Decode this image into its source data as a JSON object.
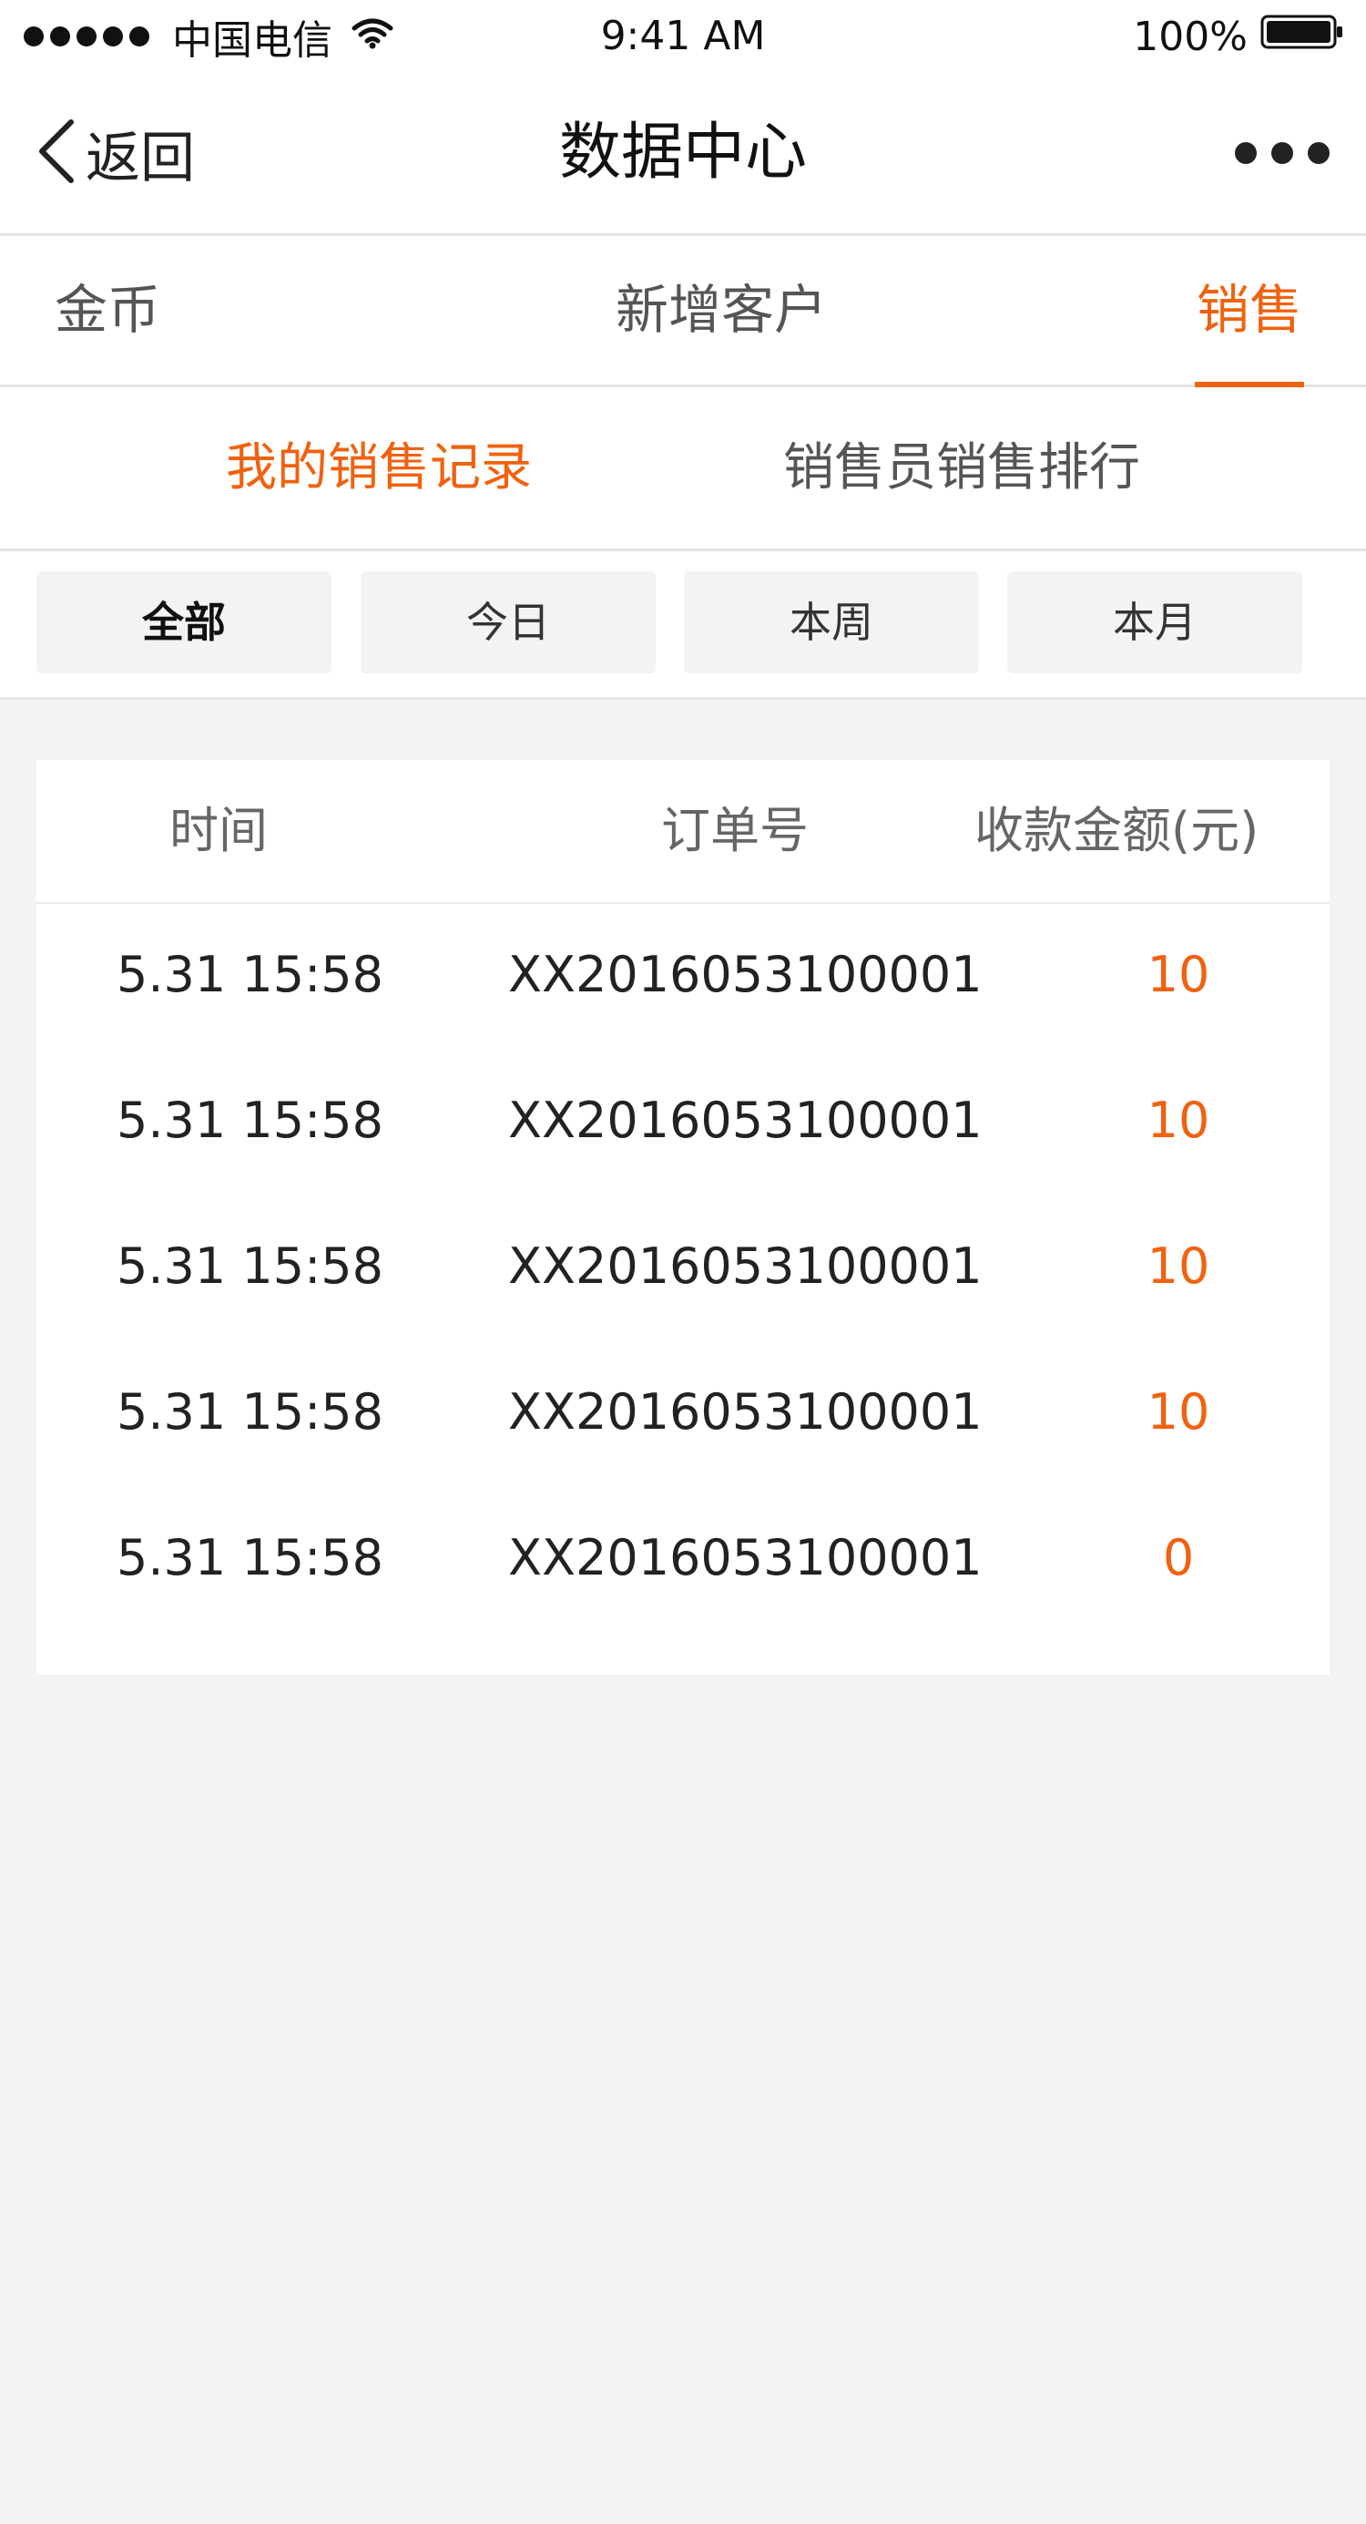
{
  "status_bar": {
    "carrier": "中国电信",
    "time": "9:41 AM",
    "battery": "100%"
  },
  "nav": {
    "back_label": "返回",
    "title": "数据中心"
  },
  "main_tabs": [
    {
      "label": "金币"
    },
    {
      "label": "新增客户"
    },
    {
      "label": "销售",
      "active": true
    }
  ],
  "sub_tabs": [
    {
      "label": "我的销售记录",
      "active": true
    },
    {
      "label": "销售员销售排行"
    }
  ],
  "filters": [
    {
      "label": "全部",
      "active": true
    },
    {
      "label": "今日"
    },
    {
      "label": "本周"
    },
    {
      "label": "本月"
    }
  ],
  "table": {
    "headers": {
      "time": "时间",
      "order": "订单号",
      "amount": "收款金额(元)"
    },
    "rows": [
      {
        "time": "5.31 15:58",
        "order": "XX2016053100001",
        "amount": "10"
      },
      {
        "time": "5.31 15:58",
        "order": "XX2016053100001",
        "amount": "10"
      },
      {
        "time": "5.31 15:58",
        "order": "XX2016053100001",
        "amount": "10"
      },
      {
        "time": "5.31 15:58",
        "order": "XX2016053100001",
        "amount": "10"
      },
      {
        "time": "5.31 15:58",
        "order": "XX2016053100001",
        "amount": "0"
      }
    ]
  },
  "colors": {
    "accent": "#f0620f",
    "background": "#f3f3f3"
  }
}
